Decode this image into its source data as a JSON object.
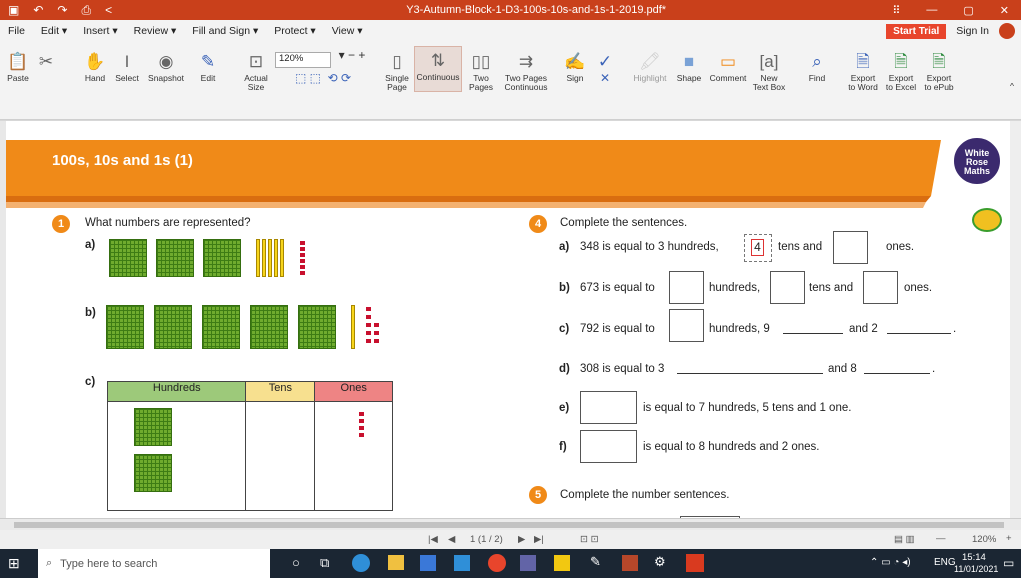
{
  "window": {
    "title": "Y3-Autumn-Block-1-D3-100s-10s-and-1s-1-2019.pdf*"
  },
  "menu": {
    "items": [
      "File",
      "Edit ▾",
      "Insert ▾",
      "Review ▾",
      "Fill and Sign ▾",
      "Protect ▾",
      "View ▾"
    ],
    "start_trial": "Start Trial",
    "sign_in": "Sign In"
  },
  "ribbon": {
    "paste": "Paste",
    "hand": "Hand",
    "select": "Select",
    "snapshot": "Snapshot",
    "edit": "Edit",
    "actual_size": "Actual Size",
    "zoom": "120%",
    "single_page": "Single Page",
    "continuous": "Continuous",
    "two_pages": "Two Pages",
    "two_pages_continuous": "Two Pages Continuous",
    "sign": "Sign",
    "highlight": "Highlight",
    "shape": "Shape",
    "comment": "Comment",
    "new_text_box": "New Text Box",
    "find": "Find",
    "export_word": "Export to Word",
    "export_excel": "Export to Excel",
    "export_epub": "Export to ePub"
  },
  "doc": {
    "banner_title": "100s, 10s and 1s (1)",
    "logo": [
      "White",
      "Rose",
      "Maths"
    ],
    "q1_num": "1",
    "q1_text": "What numbers are represented?",
    "label_a": "a)",
    "label_b": "b)",
    "label_c": "c)",
    "col_hundreds": "Hundreds",
    "col_tens": "Tens",
    "col_ones": "Ones",
    "q4_num": "4",
    "q4_text": "Complete the sentences.",
    "q4a_label": "a)",
    "q4a_pre": "348 is equal to 3 hundreds,",
    "q4a_value": "4",
    "q4a_mid": "tens and",
    "q4a_post": "ones.",
    "q4b_label": "b)",
    "q4b_pre": "673 is equal to",
    "q4b_mid1": "hundreds,",
    "q4b_mid2": "tens and",
    "q4b_post": "ones.",
    "q4c_label": "c)",
    "q4c_pre": "792 is equal to",
    "q4c_mid": "hundreds, 9",
    "q4c_and": "and 2",
    "q4c_end": ".",
    "q4d_label": "d)",
    "q4d_pre": "308 is equal to 3",
    "q4d_and": "and 8",
    "q4d_end": ".",
    "q4e_label": "e)",
    "q4e_text": "is equal to 7 hundreds, 5 tens and 1 one.",
    "q4f_label": "f)",
    "q4f_text": "is equal to 8 hundreds and 2 ones.",
    "q5_num": "5",
    "q5_text": "Complete the number sentences."
  },
  "status": {
    "page": "1 (1 / 2)",
    "zoom": "120%"
  },
  "taskbar": {
    "search": "Type here to search",
    "lang": "ENG",
    "time": "15:14",
    "date": "11/01/2021"
  },
  "colors": {
    "accent": "#c9401b",
    "banner": "#f08a18",
    "tile": "#6fab2e",
    "ones": "#c8102e",
    "tens": "#f7d51c"
  }
}
